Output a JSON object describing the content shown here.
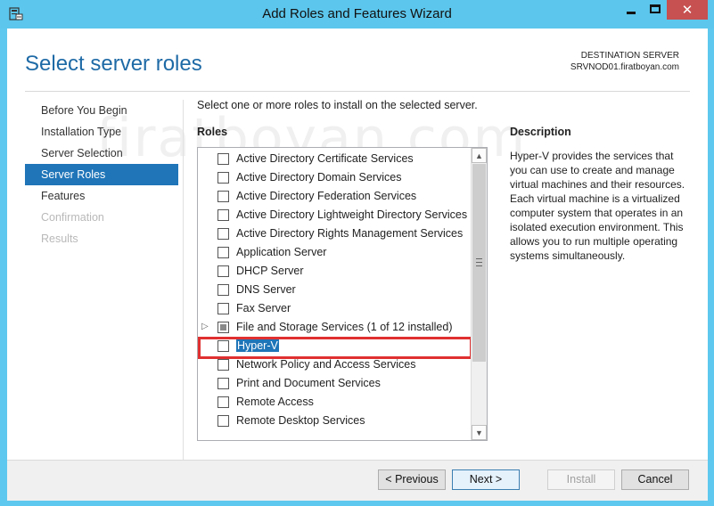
{
  "window": {
    "title": "Add Roles and Features Wizard",
    "minimize_glyph": "",
    "close_glyph": "✕"
  },
  "watermark": "firatboyan.com",
  "header": {
    "page_title": "Select server roles",
    "destination_label": "DESTINATION SERVER",
    "destination_server": "SRVNOD01.firatboyan.com"
  },
  "nav": {
    "items": [
      {
        "label": "Before You Begin",
        "state": "normal"
      },
      {
        "label": "Installation Type",
        "state": "normal"
      },
      {
        "label": "Server Selection",
        "state": "normal"
      },
      {
        "label": "Server Roles",
        "state": "active"
      },
      {
        "label": "Features",
        "state": "normal"
      },
      {
        "label": "Confirmation",
        "state": "disabled"
      },
      {
        "label": "Results",
        "state": "disabled"
      }
    ]
  },
  "main": {
    "instruction": "Select one or more roles to install on the selected server.",
    "roles_label": "Roles",
    "roles": [
      {
        "label": "Active Directory Certificate Services",
        "checked": false
      },
      {
        "label": "Active Directory Domain Services",
        "checked": false
      },
      {
        "label": "Active Directory Federation Services",
        "checked": false
      },
      {
        "label": "Active Directory Lightweight Directory Services",
        "checked": false
      },
      {
        "label": "Active Directory Rights Management Services",
        "checked": false
      },
      {
        "label": "Application Server",
        "checked": false
      },
      {
        "label": "DHCP Server",
        "checked": false
      },
      {
        "label": "DNS Server",
        "checked": false
      },
      {
        "label": "Fax Server",
        "checked": false
      },
      {
        "label": "File and Storage Services (1 of 12 installed)",
        "checked": "partial",
        "expandable": true
      },
      {
        "label": "Hyper-V",
        "checked": false,
        "selected": true
      },
      {
        "label": "Network Policy and Access Services",
        "checked": false
      },
      {
        "label": "Print and Document Services",
        "checked": false
      },
      {
        "label": "Remote Access",
        "checked": false
      },
      {
        "label": "Remote Desktop Services",
        "checked": false
      }
    ],
    "description_title": "Description",
    "description_text": "Hyper-V provides the services that you can use to create and manage virtual machines and their resources. Each virtual machine is a virtualized computer system that operates in an isolated execution environment. This allows you to run multiple operating systems simultaneously."
  },
  "footer": {
    "previous_label": "< Previous",
    "next_label": "Next >",
    "install_label": "Install",
    "cancel_label": "Cancel"
  },
  "colors": {
    "accent": "#1f75b8",
    "titlebar": "#5cc6ec",
    "highlight": "#e03030",
    "close": "#c75050"
  }
}
